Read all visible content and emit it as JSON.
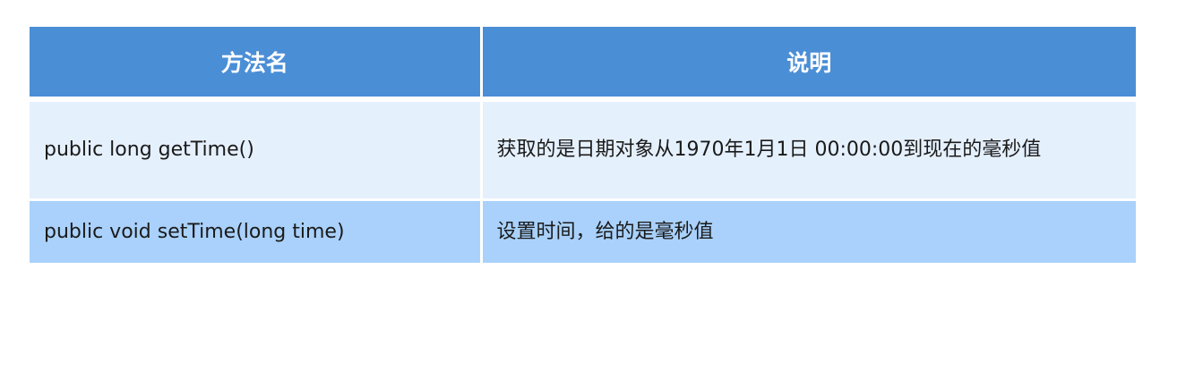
{
  "table": {
    "headers": [
      "方法名",
      "说明"
    ],
    "rows": [
      {
        "method": "public long getTime()",
        "description": "获取的是日期对象从1970年1月1日 00:00:00到现在的毫秒值"
      },
      {
        "method": "public void setTime(long time)",
        "description": "设置时间，给的是毫秒值"
      }
    ]
  },
  "colors": {
    "header_bg": "#4a8ed6",
    "header_text": "#ffffff",
    "row_odd_bg": "#e5f0fd",
    "row_even_bg": "#a9d1fb",
    "text": "#1a1a1a"
  }
}
